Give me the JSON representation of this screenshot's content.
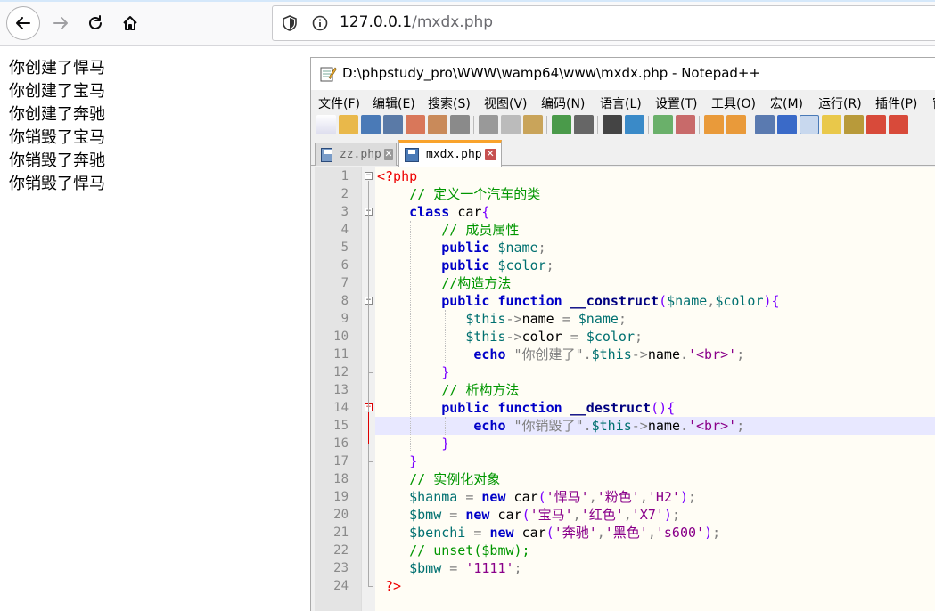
{
  "browser": {
    "url_host": "127.0.0.1",
    "url_path": "/mxdx.php"
  },
  "page_output": {
    "lines": [
      "你创建了悍马",
      "你创建了宝马",
      "你创建了奔驰",
      "你销毁了宝马",
      "你销毁了奔驰",
      "你销毁了悍马"
    ]
  },
  "notepad": {
    "title": "D:\\phpstudy_pro\\WWW\\wamp64\\www\\mxdx.php - Notepad++",
    "menu": [
      "文件(F)",
      "编辑(E)",
      "搜索(S)",
      "视图(V)",
      "编码(N)",
      "语言(L)",
      "设置(T)",
      "工具(O)",
      "宏(M)",
      "运行(R)",
      "插件(P)",
      "窗"
    ],
    "tabs": [
      {
        "label": "zz.php",
        "active": false
      },
      {
        "label": "mxdx.php",
        "active": true
      }
    ],
    "current_line": 15,
    "code_lines": [
      "<?php",
      "    // 定义一个汽车的类",
      "    class car{",
      "        // 成员属性",
      "        public $name;",
      "        public $color;",
      "        //构造方法",
      "        public function __construct($name,$color){",
      "           $this->name = $name;",
      "           $this->color = $color;",
      "            echo \"你创建了\".$this->name.'<br>';",
      "        }",
      "        // 析构方法",
      "        public function __destruct(){",
      "            echo \"你销毁了\".$this->name.'<br>';",
      "        }",
      "    }",
      "    // 实例化对象",
      "    $hanma = new car('悍马','粉色','H2');",
      "    $bmw = new car('宝马','红色','X7');",
      "    $benchi = new car('奔驰','黑色','s600');",
      "    // unset($bmw);",
      "    $bmw = '1111';",
      " ?>"
    ]
  }
}
